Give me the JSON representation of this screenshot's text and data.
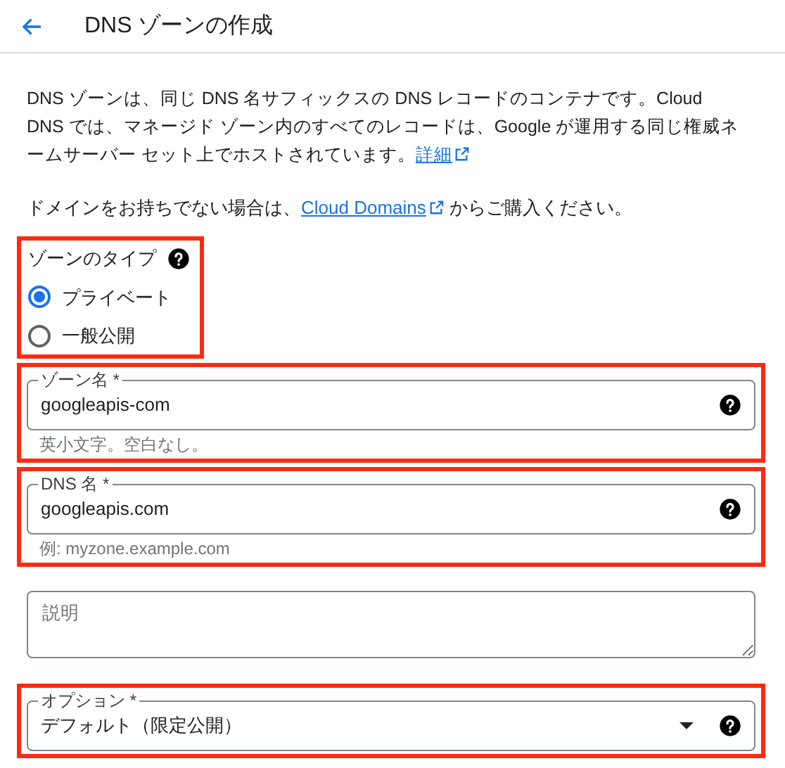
{
  "header": {
    "title": "DNS ゾーンの作成"
  },
  "intro": {
    "text": "DNS ゾーンは、同じ DNS 名サフィックスの DNS レコードのコンテナです。Cloud DNS では、マネージド ゾーン内のすべてのレコードは、Google が運用する同じ権威ネームサーバー セット上でホストされています。",
    "link": "詳細"
  },
  "domains_note": {
    "before": "ドメインをお持ちでない場合は、",
    "link": "Cloud Domains",
    "after": " からご購入ください。"
  },
  "zone_type": {
    "label": "ゾーンのタイプ",
    "highlighted": true,
    "options": [
      {
        "label": "プライベート",
        "selected": true
      },
      {
        "label": "一般公開",
        "selected": false
      }
    ]
  },
  "fields": [
    {
      "kind": "input",
      "label": "ゾーン名 *",
      "value": "googleapis-com",
      "hint": "英小文字。空白なし。",
      "highlighted": true
    },
    {
      "kind": "input",
      "label": "DNS 名 *",
      "value": "googleapis.com",
      "hint": "例: myzone.example.com",
      "highlighted": true
    },
    {
      "kind": "textarea",
      "placeholder": "説明",
      "highlighted": false
    },
    {
      "kind": "select",
      "label": "オプション *",
      "value": "デフォルト（限定公開）",
      "highlighted": true
    }
  ]
}
